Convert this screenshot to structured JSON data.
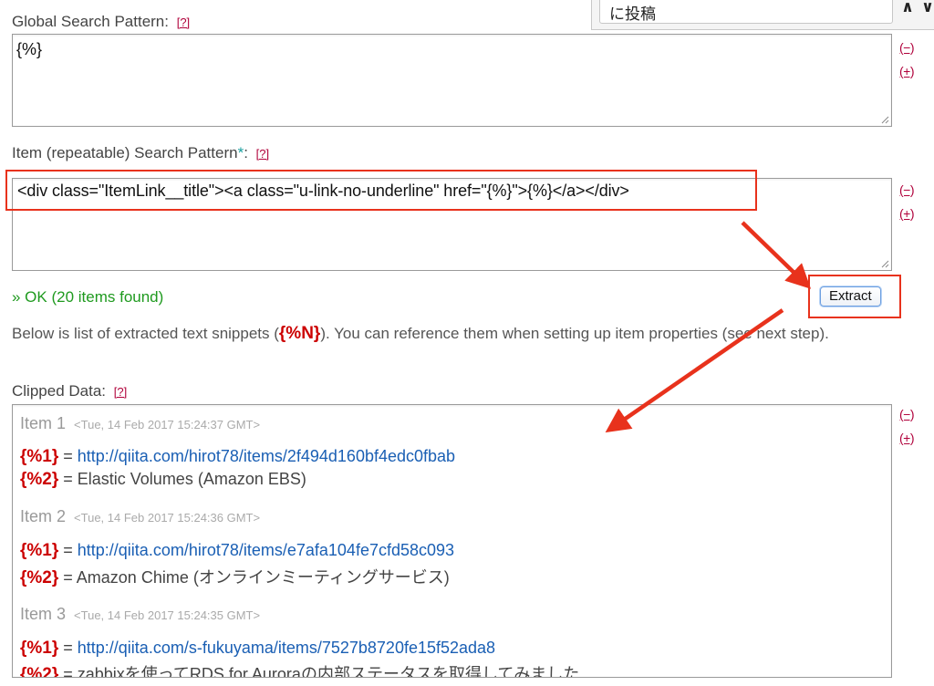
{
  "top_dropdown": {
    "value": "に投稿",
    "up_glyph": "∧",
    "down_glyph": "∨"
  },
  "global_pattern": {
    "label": "Global Search Pattern:",
    "help": "[?]",
    "value": "{%}",
    "minus": "(−)",
    "plus": "(+)"
  },
  "item_pattern": {
    "label": "Item (repeatable) Search Pattern",
    "required_mark": "*",
    "colon": ":",
    "help": "[?]",
    "value": "<div class=\"ItemLink__title\"><a class=\"u-link-no-underline\" href=\"{%}\">{%}</a></div>",
    "minus": "(−)",
    "plus": "(+)"
  },
  "status": {
    "ok_text": "» OK (20 items found)"
  },
  "extract_button": {
    "label": "Extract"
  },
  "description": {
    "before": "Below is list of extracted text snippets (",
    "var": "{%N}",
    "after": "). You can reference them when setting up item properties (see next step)."
  },
  "clipped": {
    "label": "Clipped Data:",
    "help": "[?]",
    "minus": "(−)",
    "plus": "(+)",
    "items": [
      {
        "title": "Item 1",
        "date": "<Tue, 14 Feb 2017 15:24:37 GMT>",
        "var1": "{%1}",
        "eq1": " = ",
        "val1": "http://qiita.com/hirot78/items/2f494d160bf4edc0fbab",
        "var2": "{%2}",
        "eq2": " = ",
        "val2": "Elastic Volumes (Amazon EBS)"
      },
      {
        "title": "Item 2",
        "date": "<Tue, 14 Feb 2017 15:24:36 GMT>",
        "var1": "{%1}",
        "eq1": " = ",
        "val1": "http://qiita.com/hirot78/items/e7afa104fe7cfd58c093",
        "var2": "{%2}",
        "eq2": " = ",
        "val2": "Amazon Chime (オンラインミーティングサービス)"
      },
      {
        "title": "Item 3",
        "date": "<Tue, 14 Feb 2017 15:24:35 GMT>",
        "var1": "{%1}",
        "eq1": " = ",
        "val1": "http://qiita.com/s-fukuyama/items/7527b8720fe15f52ada8",
        "var2": "{%2}",
        "eq2": " = ",
        "val2": "zabbixを使ってRDS for Auroraの内部ステータスを取得してみました"
      }
    ]
  },
  "colors": {
    "highlight": "#e8321c",
    "ok_green": "#1f9a1f",
    "var_red": "#cc0000",
    "link_blue": "#1a5fb4",
    "help_crimson": "#b0003a"
  }
}
